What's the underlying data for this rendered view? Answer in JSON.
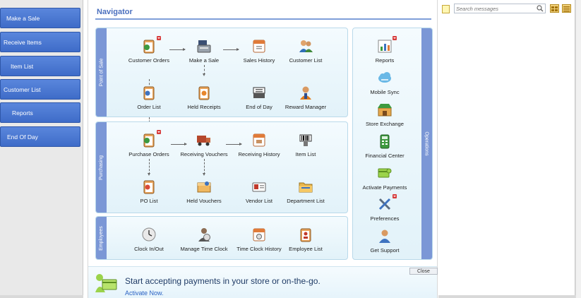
{
  "sidebar": {
    "items": [
      {
        "label": "Make a Sale"
      },
      {
        "label": "Receive Items"
      },
      {
        "label": "Item List"
      },
      {
        "label": "Customer List"
      },
      {
        "label": "Reports"
      },
      {
        "label": "End Of Day"
      }
    ]
  },
  "navigator": {
    "title": "Navigator",
    "sections": {
      "point_of_sale": {
        "tab": "Point of Sale",
        "items": [
          "Customer Orders",
          "Make a Sale",
          "Sales History",
          "Customer List",
          "Order List",
          "Held Receipts",
          "End of Day",
          "Reward Manager"
        ]
      },
      "purchasing": {
        "tab": "Purchasing",
        "items": [
          "Purchase Orders",
          "Receiving Vouchers",
          "Receiving History",
          "Item List",
          "PO List",
          "Held Vouchers",
          "Vendor List",
          "Department List"
        ]
      },
      "employees": {
        "tab": "Employees",
        "items": [
          "Clock In/Out",
          "Manage Time Clock",
          "Time Clock History",
          "Employee List"
        ]
      },
      "operations": {
        "tab": "Operations",
        "items": [
          "Reports",
          "Mobile Sync",
          "Store Exchange",
          "Financial Center",
          "Activate Payments",
          "Preferences",
          "Get Support"
        ]
      }
    }
  },
  "banner": {
    "text": "Start accepting payments in your store or on-the-go.",
    "link": "Activate Now.",
    "close": "Close"
  },
  "messages": {
    "search_placeholder": "Search messages"
  },
  "colors": {
    "sidebar_button": "#4a78d4",
    "section_tab": "#7b97d6",
    "section_bg": "#e8f5fb",
    "title": "#4a6fbe"
  }
}
